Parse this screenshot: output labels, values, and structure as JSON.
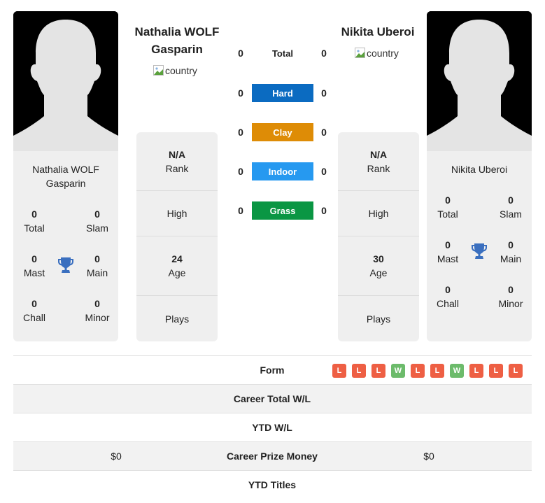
{
  "player1": {
    "name": "Nathalia WOLF Gasparin",
    "header_name_line1": "Nathalia WOLF",
    "header_name_line2": "Gasparin",
    "country_alt": "country",
    "titles": {
      "total": {
        "value": "0",
        "label": "Total"
      },
      "slam": {
        "value": "0",
        "label": "Slam"
      },
      "mast": {
        "value": "0",
        "label": "Mast"
      },
      "main": {
        "value": "0",
        "label": "Main"
      },
      "chall": {
        "value": "0",
        "label": "Chall"
      },
      "minor": {
        "value": "0",
        "label": "Minor"
      }
    },
    "info": {
      "rank_value": "N/A",
      "rank_label": "Rank",
      "high_label": "High",
      "age_value": "24",
      "age_label": "Age",
      "plays_label": "Plays"
    },
    "prize_money": "$0"
  },
  "player2": {
    "name": "Nikita Uberoi",
    "country_alt": "country",
    "titles": {
      "total": {
        "value": "0",
        "label": "Total"
      },
      "slam": {
        "value": "0",
        "label": "Slam"
      },
      "mast": {
        "value": "0",
        "label": "Mast"
      },
      "main": {
        "value": "0",
        "label": "Main"
      },
      "chall": {
        "value": "0",
        "label": "Chall"
      },
      "minor": {
        "value": "0",
        "label": "Minor"
      }
    },
    "info": {
      "rank_value": "N/A",
      "rank_label": "Rank",
      "high_label": "High",
      "age_value": "30",
      "age_label": "Age",
      "plays_label": "Plays"
    },
    "prize_money": "$0"
  },
  "surfaces": [
    {
      "label": "Total",
      "left": "0",
      "right": "0",
      "color": ""
    },
    {
      "label": "Hard",
      "left": "0",
      "right": "0",
      "color": "#0b6bc1"
    },
    {
      "label": "Clay",
      "left": "0",
      "right": "0",
      "color": "#de8c06"
    },
    {
      "label": "Indoor",
      "left": "0",
      "right": "0",
      "color": "#2699f0"
    },
    {
      "label": "Grass",
      "left": "0",
      "right": "0",
      "color": "#0a9643"
    }
  ],
  "comparison": {
    "form_label": "Form",
    "form": [
      "L",
      "L",
      "L",
      "W",
      "L",
      "L",
      "W",
      "L",
      "L",
      "L"
    ],
    "career_total_wl_label": "Career Total W/L",
    "ytd_wl_label": "YTD W/L",
    "career_prize_money_label": "Career Prize Money",
    "ytd_titles_label": "YTD Titles"
  },
  "colors": {
    "loss": "#ee5f44",
    "win": "#6cbb6b",
    "trophy": "#3a6fbf",
    "card_bg": "#efefef"
  }
}
